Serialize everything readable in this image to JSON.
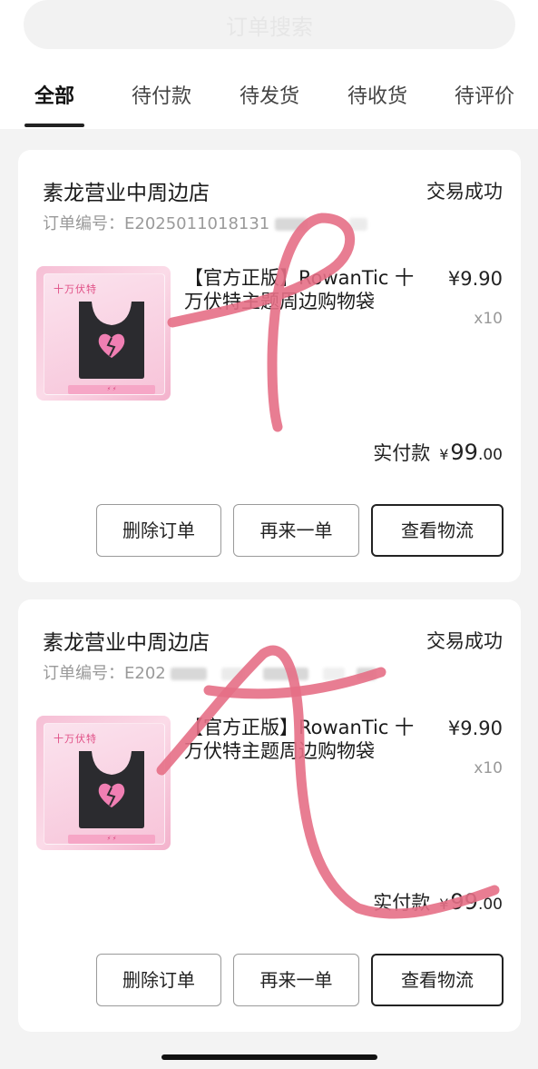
{
  "search": {
    "placeholder": "订单搜索"
  },
  "tabs": [
    {
      "label": "全部"
    },
    {
      "label": "待付款"
    },
    {
      "label": "待发货"
    },
    {
      "label": "待收货"
    },
    {
      "label": "待评价"
    }
  ],
  "orders": [
    {
      "shop": "素龙营业中周边店",
      "status": "交易成功",
      "order_no_label": "订单编号：",
      "order_no_visible": "E2025011018131",
      "product": {
        "title": "【官方正版】RowanTic 十万伏特主题周边购物袋",
        "price": "¥9.90",
        "qty": "x10",
        "image_brand": "十万伏特"
      },
      "paid_label": "实付款",
      "paid_currency": "¥",
      "paid_int": "99",
      "paid_dec": ".00",
      "buttons": {
        "delete": "删除订单",
        "rebuy": "再来一单",
        "logistics": "查看物流"
      }
    },
    {
      "shop": "素龙营业中周边店",
      "status": "交易成功",
      "order_no_label": "订单编号：",
      "order_no_visible": "E202",
      "product": {
        "title": "【官方正版】RowanTic 十万伏特主题周边购物袋",
        "price": "¥9.90",
        "qty": "x10",
        "image_brand": "十万伏特"
      },
      "paid_label": "实付款",
      "paid_currency": "¥",
      "paid_int": "99",
      "paid_dec": ".00",
      "buttons": {
        "delete": "删除订单",
        "rebuy": "再来一单",
        "logistics": "查看物流"
      }
    }
  ],
  "colors": {
    "scribble": "#e56f86",
    "thumb_pink": "#f6bfd5",
    "accent_text": "#1a1a1a"
  }
}
